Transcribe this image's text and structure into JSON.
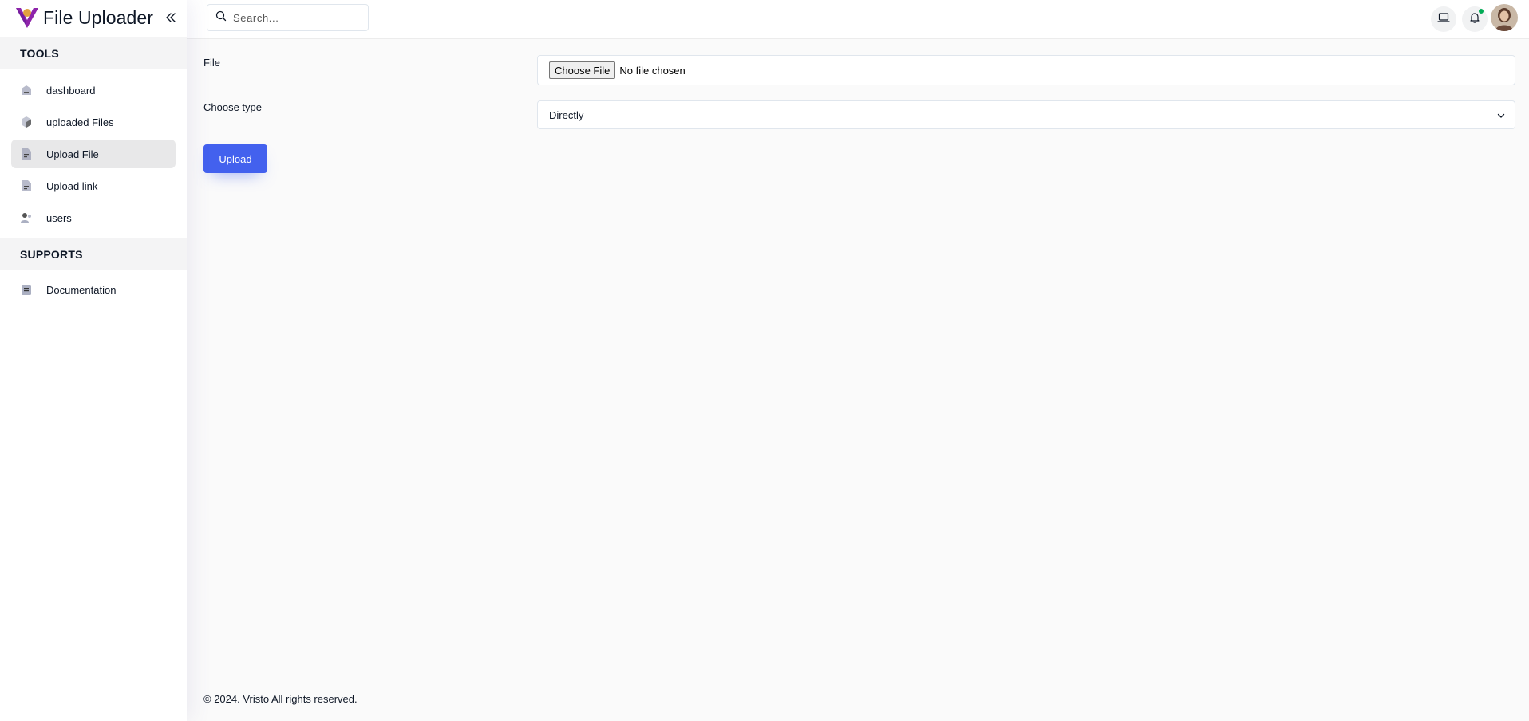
{
  "app": {
    "name": "File Uploader",
    "brand_colors": {
      "logo_primary": "#8e24aa",
      "logo_accent": "#e2a03f",
      "accent": "#4361ee",
      "online": "#00ab55"
    }
  },
  "sidebar": {
    "sections": [
      {
        "title": "TOOLS",
        "items": [
          {
            "label": "dashboard",
            "icon": "dashboard-icon",
            "active": false
          },
          {
            "label": "uploaded Files",
            "icon": "cube-icon",
            "active": false
          },
          {
            "label": "Upload File",
            "icon": "document-icon",
            "active": true
          },
          {
            "label": "Upload link",
            "icon": "document-icon",
            "active": false
          },
          {
            "label": "users",
            "icon": "users-icon",
            "active": false
          }
        ]
      },
      {
        "title": "SUPPORTS",
        "items": [
          {
            "label": "Documentation",
            "icon": "book-icon",
            "active": false
          }
        ]
      }
    ]
  },
  "header": {
    "search": {
      "placeholder": "Search...",
      "value": ""
    },
    "icons": [
      "laptop-icon",
      "bell-icon",
      "avatar"
    ]
  },
  "form": {
    "file_label": "File",
    "choose_button": "Choose File",
    "file_status": "No file chosen",
    "type_label": "Choose type",
    "type_value": "Directly",
    "submit_label": "Upload"
  },
  "footer": {
    "text": "© 2024. Vristo All rights reserved."
  }
}
